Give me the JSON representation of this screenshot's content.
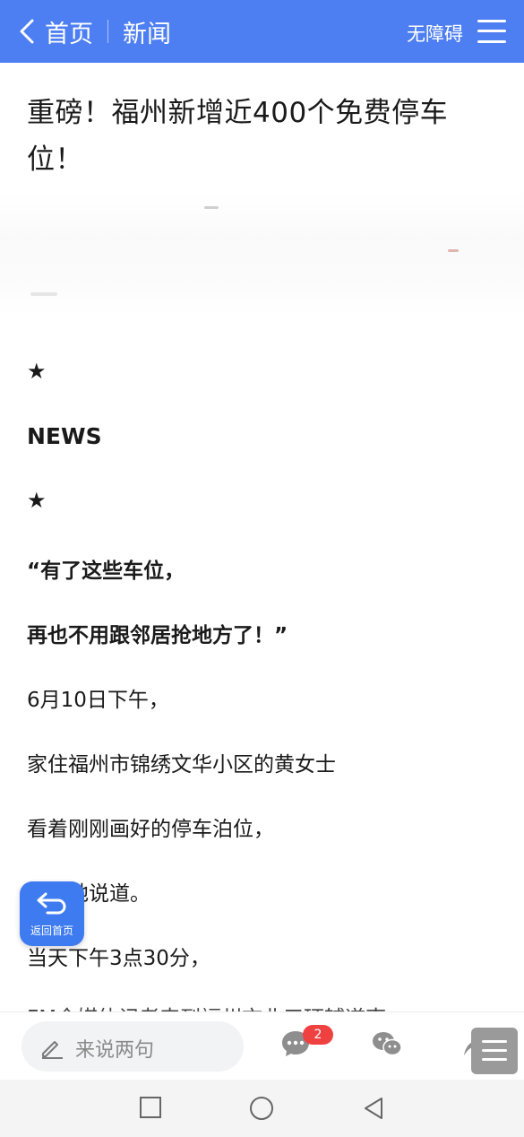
{
  "header": {
    "home_label": "首页",
    "section_label": "新闻",
    "accessibility_label": "无障碍"
  },
  "article": {
    "title": "重磅！福州新增近400个免费停车位！",
    "paragraphs": [
      "★",
      "NEWS",
      "★",
      "“有了这些车位，",
      "再也不用跟邻居抢地方了！”",
      "6月10日下午，",
      "家住福州市锦绣文华小区的黄女士",
      "看着刚刚画好的停车泊位，",
      "开心地说道。",
      "当天下午3点30分，",
      "FM全媒体记者来到福州市北三环辅道南"
    ]
  },
  "floating_button": {
    "label": "返回首页"
  },
  "bottom_bar": {
    "comment_placeholder": "来说两句",
    "comment_count": "2"
  },
  "icons": {
    "back": "chevron-left-icon",
    "menu": "hamburger-icon",
    "return_home": "return-arrow-icon",
    "pencil": "pencil-icon",
    "comment": "comment-bubble-icon",
    "wechat": "wechat-icon",
    "share": "share-arrow-icon",
    "more": "more-menu-icon",
    "sys_recent": "square-icon",
    "sys_home": "circle-icon",
    "sys_back": "triangle-back-icon"
  },
  "colors": {
    "header_bg": "#4d7ef2",
    "fab_bg": "#3e7bf0",
    "badge_bg": "#f04141"
  }
}
